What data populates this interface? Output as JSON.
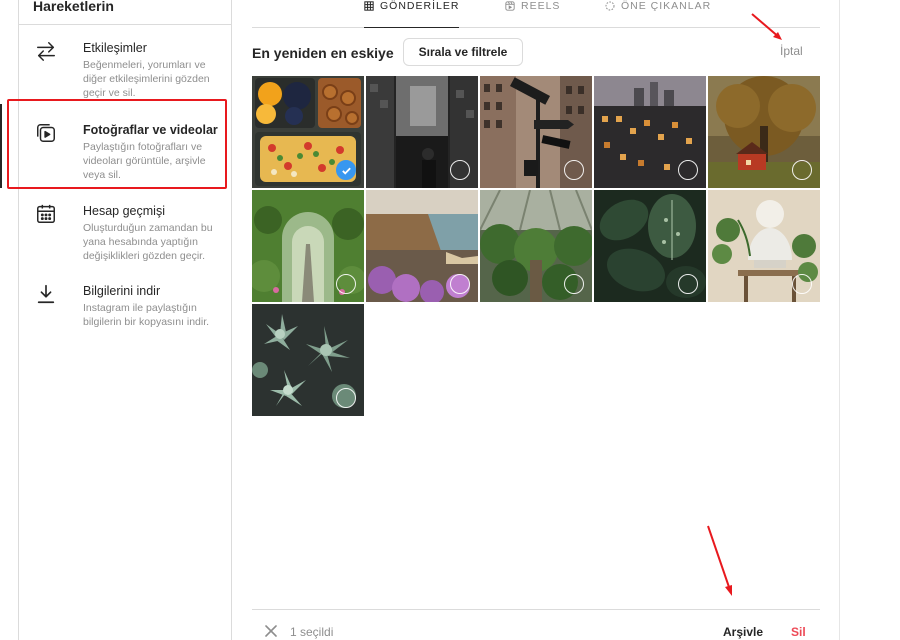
{
  "sidebar": {
    "title": "Hareketlerin",
    "items": [
      {
        "label": "Etkileşimler",
        "desc": "Beğenmeleri, yorumları ve diğer etkileşimlerini gözden geçir ve sil.",
        "icon": "arrows-swap-icon"
      },
      {
        "label": "Fotoğraflar ve videolar",
        "desc": "Paylaştığın fotoğrafları ve videoları görüntüle, arşivle veya sil.",
        "icon": "photos-videos-icon"
      },
      {
        "label": "Hesap geçmişi",
        "desc": "Oluşturduğun zamandan bu yana hesabında yaptığın değişiklikleri gözden geçir.",
        "icon": "calendar-icon"
      },
      {
        "label": "Bilgilerini indir",
        "desc": "Instagram ile paylaştığın bilgilerin bir kopyasını indir.",
        "icon": "download-icon"
      }
    ],
    "active_index": 1
  },
  "tabs": [
    {
      "label": "GÖNDERİLER",
      "icon": "grid-icon",
      "active": true
    },
    {
      "label": "REELS",
      "icon": "reels-icon",
      "active": false
    },
    {
      "label": "ÖNE ÇIKANLAR",
      "icon": "highlights-icon",
      "active": false
    }
  ],
  "toolbar": {
    "sort_title": "En yeniden en eskiye",
    "sort_button": "Sırala ve filtrele",
    "cancel": "İptal"
  },
  "posts": [
    {
      "name": "food-bento",
      "selected": true
    },
    {
      "name": "city-street-night",
      "selected": false
    },
    {
      "name": "wall-street-signs",
      "selected": false
    },
    {
      "name": "city-buildings-dusk",
      "selected": false
    },
    {
      "name": "autumn-tree-house",
      "selected": false
    },
    {
      "name": "garden-arch-path",
      "selected": false
    },
    {
      "name": "coast-cliffs-flowers",
      "selected": false
    },
    {
      "name": "greenhouse-plants",
      "selected": false
    },
    {
      "name": "dark-leaves",
      "selected": false
    },
    {
      "name": "marble-bust-plants",
      "selected": false
    },
    {
      "name": "succulents",
      "selected": false
    }
  ],
  "bottom_bar": {
    "selected_count": "1 seçildi",
    "archive": "Arşivle",
    "delete": "Sil"
  },
  "colors": {
    "annotation_red": "#e8191e",
    "delete_red": "#ed4956",
    "select_blue": "#3797f0"
  }
}
